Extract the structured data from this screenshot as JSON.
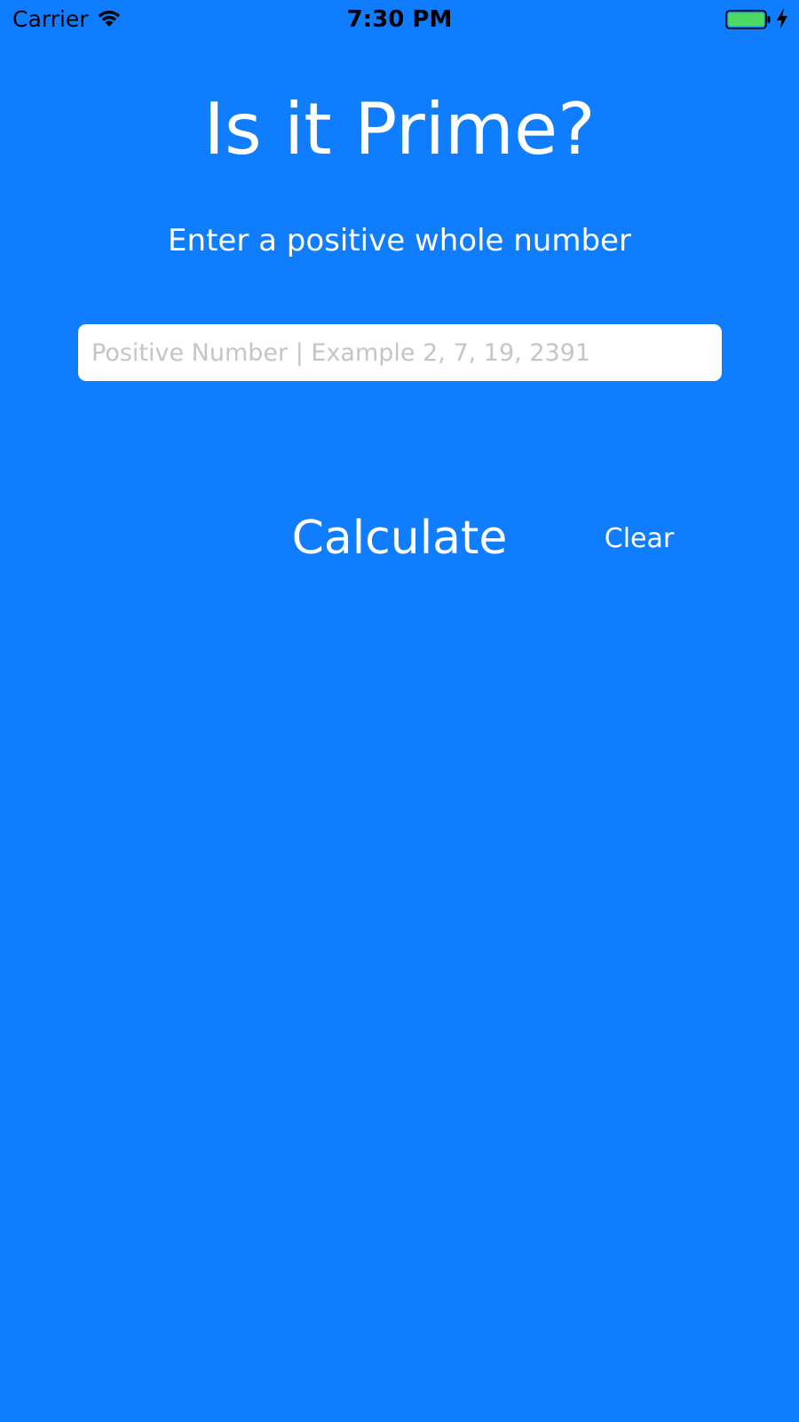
{
  "status_bar": {
    "carrier": "Carrier",
    "time": "7:30 PM",
    "wifi_icon": "wifi-icon",
    "battery_icon": "battery-icon",
    "charging_icon": "charging-bolt-icon",
    "battery_level": 1.0,
    "battery_color": "#4cd964"
  },
  "main": {
    "title": "Is it Prime?",
    "subtitle": "Enter a positive whole number",
    "input": {
      "value": "",
      "placeholder": "Positive Number | Example 2, 7, 19, 2391"
    },
    "calculate_label": "Calculate",
    "clear_label": "Clear"
  },
  "colors": {
    "background": "#0f7dfd",
    "text": "#ffffff",
    "placeholder": "#c4c4c9"
  }
}
